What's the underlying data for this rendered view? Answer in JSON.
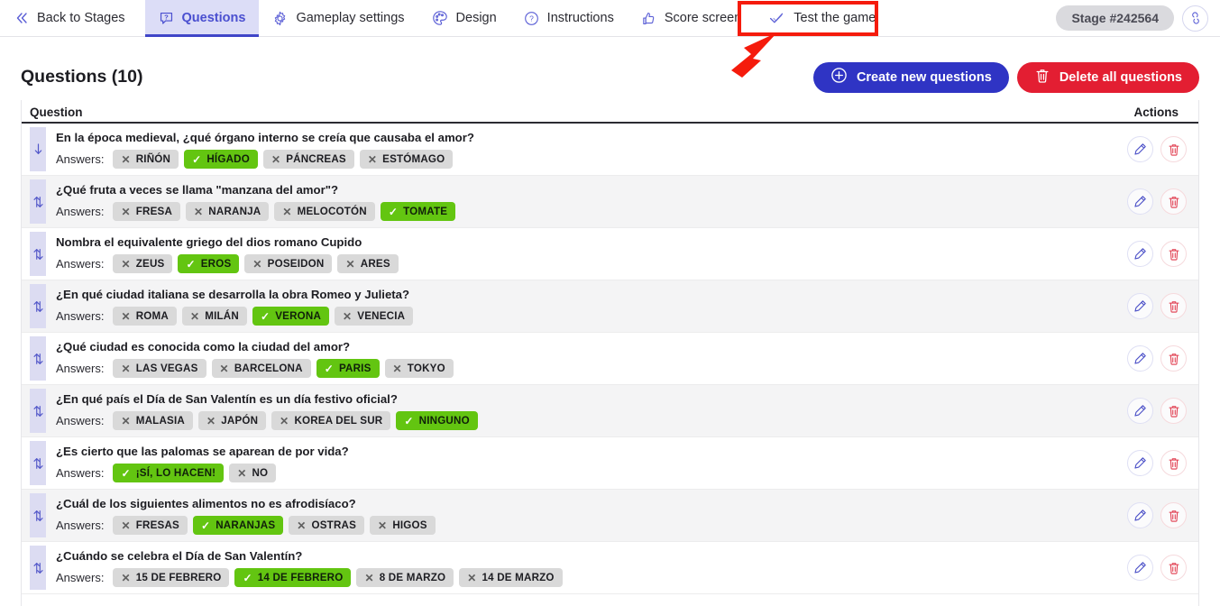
{
  "navbar": {
    "back_label": "Back to Stages",
    "tabs": [
      {
        "label": "Questions",
        "icon": "question-bubble-icon",
        "active": true
      },
      {
        "label": "Gameplay settings",
        "icon": "gear-icon",
        "active": false
      },
      {
        "label": "Design",
        "icon": "palette-icon",
        "active": false
      },
      {
        "label": "Instructions",
        "icon": "question-circle-icon",
        "active": false
      },
      {
        "label": "Score screen",
        "icon": "thumbs-up-icon",
        "active": false
      },
      {
        "label": "Test the game",
        "icon": "check-icon",
        "active": false
      }
    ],
    "stage_badge": "Stage #242564",
    "link_icon": "link-icon"
  },
  "annotation": {
    "highlight_target": "Test the game",
    "color": "#f51b0c"
  },
  "header": {
    "title": "Questions (10)",
    "create_button": "Create new questions",
    "delete_button": "Delete all questions",
    "create_color": "#2f34c4",
    "delete_color": "#e31e32"
  },
  "table": {
    "columns": {
      "question": "Question",
      "actions": "Actions"
    },
    "answers_label": "Answers:",
    "correct_color": "#63c511",
    "wrong_color": "#d9d9d9",
    "rows": [
      {
        "question": "En la época medieval, ¿qué órgano interno se creía que causaba el amor?",
        "drag": "down-arrow-icon",
        "answers": [
          {
            "text": "RIÑÓN",
            "correct": false
          },
          {
            "text": "HÍGADO",
            "correct": true
          },
          {
            "text": "PÁNCREAS",
            "correct": false
          },
          {
            "text": "ESTÓMAGO",
            "correct": false
          }
        ]
      },
      {
        "question": "¿Qué fruta a veces se llama \"manzana del amor\"?",
        "drag": "up-down-arrow-icon",
        "answers": [
          {
            "text": "FRESA",
            "correct": false
          },
          {
            "text": "NARANJA",
            "correct": false
          },
          {
            "text": "MELOCOTÓN",
            "correct": false
          },
          {
            "text": "TOMATE",
            "correct": true
          }
        ]
      },
      {
        "question": "Nombra el equivalente griego del dios romano Cupido",
        "drag": "up-down-arrow-icon",
        "answers": [
          {
            "text": "ZEUS",
            "correct": false
          },
          {
            "text": "EROS",
            "correct": true
          },
          {
            "text": "POSEIDON",
            "correct": false
          },
          {
            "text": "ARES",
            "correct": false
          }
        ]
      },
      {
        "question": "¿En qué ciudad italiana se desarrolla la obra Romeo y Julieta?",
        "drag": "up-down-arrow-icon",
        "answers": [
          {
            "text": "ROMA",
            "correct": false
          },
          {
            "text": "MILÁN",
            "correct": false
          },
          {
            "text": "VERONA",
            "correct": true
          },
          {
            "text": "VENECIA",
            "correct": false
          }
        ]
      },
      {
        "question": "¿Qué ciudad es conocida como la ciudad del amor?",
        "drag": "up-down-arrow-icon",
        "answers": [
          {
            "text": "LAS VEGAS",
            "correct": false
          },
          {
            "text": "BARCELONA",
            "correct": false
          },
          {
            "text": "PARIS",
            "correct": true
          },
          {
            "text": "TOKYO",
            "correct": false
          }
        ]
      },
      {
        "question": "¿En qué país el Día de San Valentín es un día festivo oficial?",
        "drag": "up-down-arrow-icon",
        "answers": [
          {
            "text": "MALASIA",
            "correct": false
          },
          {
            "text": "JAPÓN",
            "correct": false
          },
          {
            "text": "KOREA DEL SUR",
            "correct": false
          },
          {
            "text": "NINGUNO",
            "correct": true
          }
        ]
      },
      {
        "question": "¿Es cierto que las palomas se aparean de por vida?",
        "drag": "up-down-arrow-icon",
        "answers": [
          {
            "text": "¡SÍ, LO HACEN!",
            "correct": true
          },
          {
            "text": "NO",
            "correct": false
          }
        ]
      },
      {
        "question": "¿Cuál de los siguientes alimentos no es afrodisíaco?",
        "drag": "up-down-arrow-icon",
        "answers": [
          {
            "text": "FRESAS",
            "correct": false
          },
          {
            "text": "NARANJAS",
            "correct": true
          },
          {
            "text": "OSTRAS",
            "correct": false
          },
          {
            "text": "HIGOS",
            "correct": false
          }
        ]
      },
      {
        "question": "¿Cuándo se celebra el Día de San Valentín?",
        "drag": "up-down-arrow-icon",
        "answers": [
          {
            "text": "15 DE FEBRERO",
            "correct": false
          },
          {
            "text": "14 DE FEBRERO",
            "correct": true
          },
          {
            "text": "8 DE MARZO",
            "correct": false
          },
          {
            "text": "14 DE MARZO",
            "correct": false
          }
        ]
      }
    ],
    "row_actions": {
      "edit": "edit-icon",
      "delete": "delete-icon"
    }
  }
}
